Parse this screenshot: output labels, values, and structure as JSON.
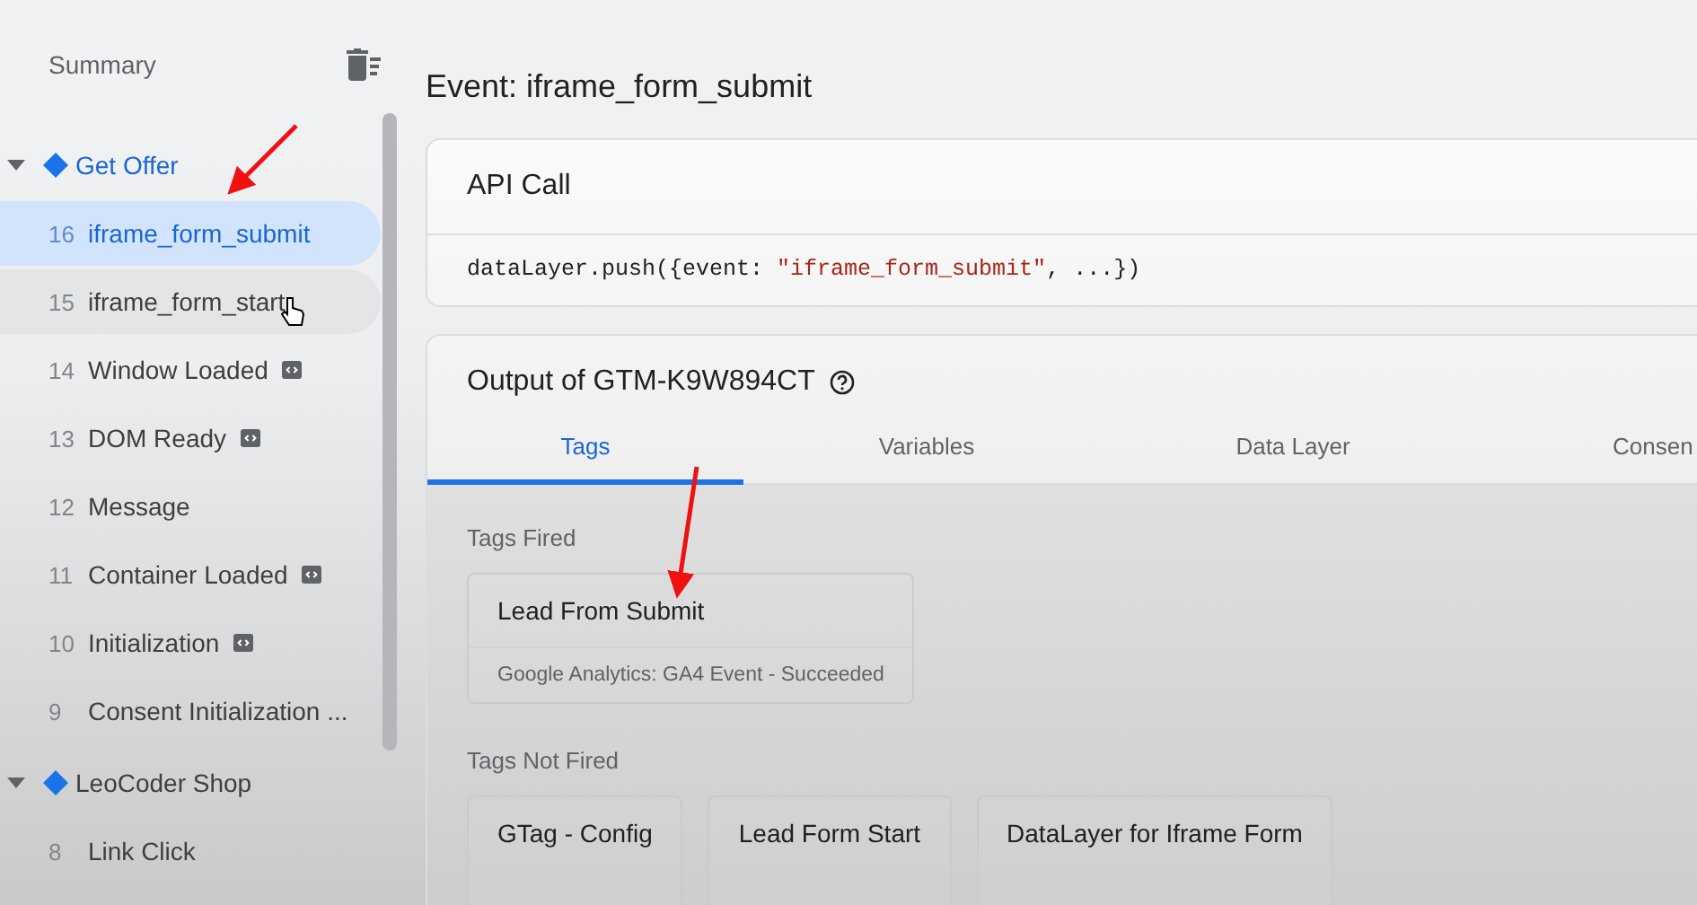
{
  "sidebar": {
    "summary": "Summary",
    "groups": [
      {
        "name": "Get Offer",
        "expanded": true,
        "items": [
          {
            "number": "16",
            "label": "iframe_form_submit",
            "selected": true,
            "hovered": false,
            "badge": false
          },
          {
            "number": "15",
            "label": "iframe_form_start",
            "selected": false,
            "hovered": true,
            "badge": false
          },
          {
            "number": "14",
            "label": "Window Loaded",
            "selected": false,
            "hovered": false,
            "badge": true
          },
          {
            "number": "13",
            "label": "DOM Ready",
            "selected": false,
            "hovered": false,
            "badge": true
          },
          {
            "number": "12",
            "label": "Message",
            "selected": false,
            "hovered": false,
            "badge": false
          },
          {
            "number": "11",
            "label": "Container Loaded",
            "selected": false,
            "hovered": false,
            "badge": true
          },
          {
            "number": "10",
            "label": "Initialization",
            "selected": false,
            "hovered": false,
            "badge": true
          },
          {
            "number": "9",
            "label": "Consent Initialization ...",
            "selected": false,
            "hovered": false,
            "badge": false
          }
        ]
      },
      {
        "name": "LeoCoder Shop",
        "expanded": true,
        "items": [
          {
            "number": "8",
            "label": "Link Click",
            "selected": false,
            "hovered": false,
            "badge": false
          }
        ]
      }
    ]
  },
  "event_title": "Event: iframe_form_submit",
  "api_call": {
    "title": "API Call",
    "code_prefix": "dataLayer.push({event: ",
    "code_string": "\"iframe_form_submit\"",
    "code_suffix": ", ...})"
  },
  "output": {
    "title": "Output of GTM-K9W894CT",
    "tabs": [
      {
        "label": "Tags",
        "selected": true
      },
      {
        "label": "Variables",
        "selected": false
      },
      {
        "label": "Data Layer",
        "selected": false
      },
      {
        "label": "Consen",
        "selected": false
      }
    ],
    "sections": [
      {
        "title": "Tags Fired",
        "tags": [
          {
            "name": "Lead From Submit",
            "detail": "Google Analytics: GA4 Event - Succeeded"
          }
        ]
      },
      {
        "title": "Tags Not Fired",
        "tags": [
          {
            "name": "GTag - Config"
          },
          {
            "name": "Lead Form Start"
          },
          {
            "name": "DataLayer for Iframe Form"
          }
        ]
      }
    ]
  }
}
